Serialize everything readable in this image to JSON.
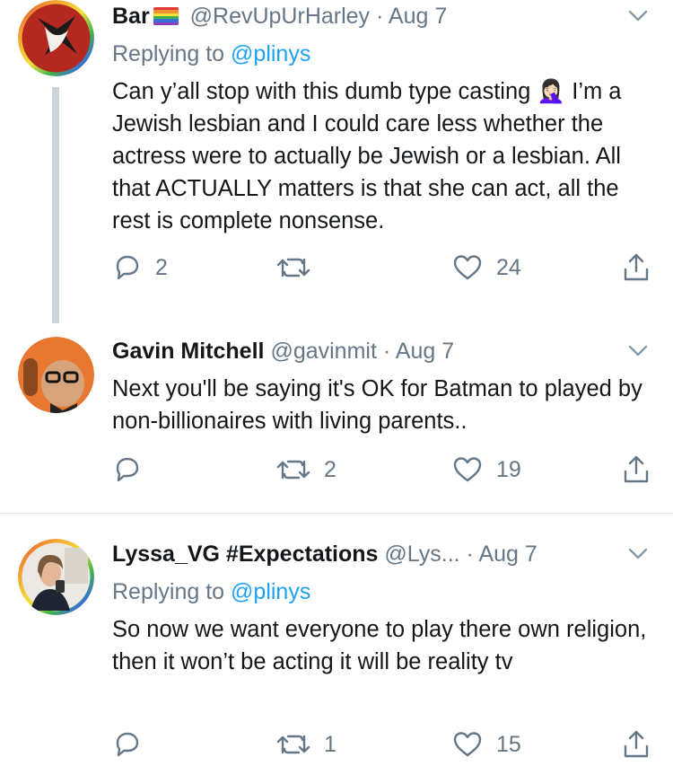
{
  "tweets": [
    {
      "name": "Bar",
      "name_flag": "rainbow-flag",
      "handle": "@RevUpUrHarley",
      "dot": "·",
      "time": "Aug 7",
      "replying_prefix": "Replying to",
      "replying_to": "@plinys",
      "body": "Can y’all stop with this dumb type casting 🤦🏻‍♀️ I’m a Jewish lesbian and I could care less whether the actress were to actually be Jewish or a lesbian. All that ACTUALLY matters is that she can act, all the rest is complete nonsense.",
      "replies": "2",
      "retweets": "",
      "likes": "24"
    },
    {
      "name": "Gavin Mitchell",
      "handle": "@gavinmit",
      "dot": "·",
      "time": "Aug 7",
      "body": "Next you'll be saying it's OK for Batman to played by non-billionaires with living parents..",
      "replies": "",
      "retweets": "2",
      "likes": "19"
    },
    {
      "name": "Lyssa_VG #Expectations",
      "handle": "@Lys...",
      "dot": "·",
      "time": "Aug 7",
      "replying_prefix": "Replying to",
      "replying_to": "@plinys",
      "body": "So now we want everyone to play there own religion, then it won’t be acting it will be reality tv",
      "replies": "",
      "retweets": "1",
      "likes": "15"
    }
  ],
  "colors": {
    "text": "#14171a",
    "secondary": "#657786",
    "link": "#1da1f2",
    "thread_line": "#cdd4da",
    "divider": "#e1e8ed"
  },
  "icons": [
    "reply-icon",
    "retweet-icon",
    "like-icon",
    "share-icon",
    "chevron-down-icon"
  ]
}
